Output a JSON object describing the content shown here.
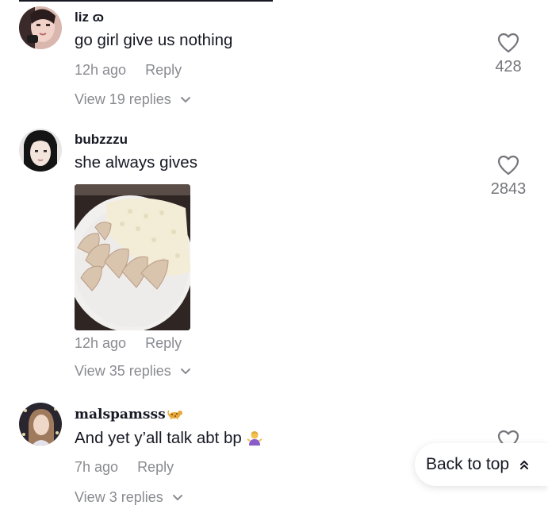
{
  "comments": [
    {
      "username": "liz ɷ",
      "text": "go girl give us nothing",
      "time": "12h ago",
      "reply_label": "Reply",
      "view_replies": "View 19 replies",
      "likes": "428",
      "avatar_icon": "avatar-photo-icon"
    },
    {
      "username": "bubzzzu",
      "text": "she always gives",
      "time": "12h ago",
      "reply_label": "Reply",
      "view_replies": "View 35 replies",
      "likes": "2843",
      "avatar_icon": "avatar-photo-icon",
      "attachment_icon": "food-photo-icon"
    },
    {
      "username": "malspamsss",
      "username_emoji": "leopard-emoji-icon",
      "text": "And yet y’all talk abt bp",
      "text_emoji": "person-shrugging-emoji-icon",
      "time": "7h ago",
      "reply_label": "Reply",
      "view_replies": "View 3 replies",
      "likes": "",
      "avatar_icon": "avatar-photo-icon"
    }
  ],
  "back_to_top": {
    "label": "Back to top",
    "icon": "double-chevron-up-icon"
  },
  "colors": {
    "text": "#161823",
    "muted": "#8a8b91",
    "like_count": "#75767c",
    "background": "#ffffff"
  }
}
